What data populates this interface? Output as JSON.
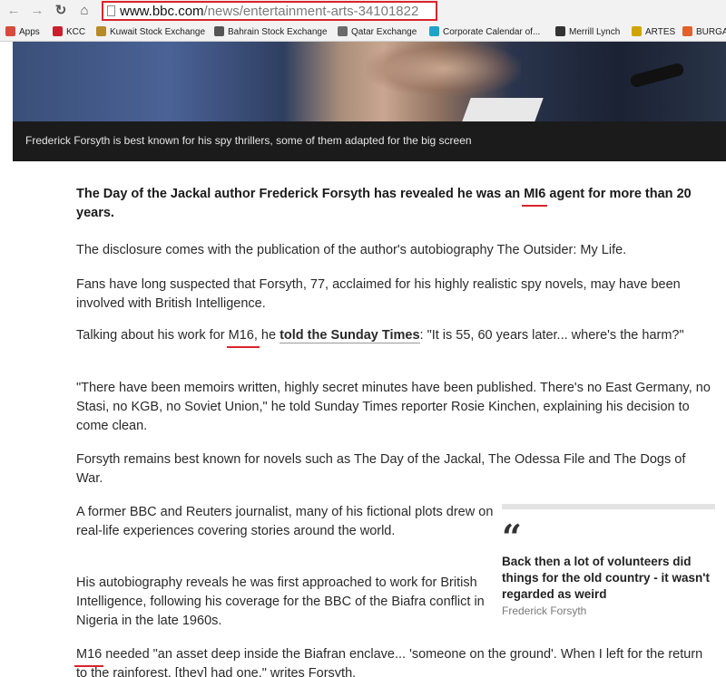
{
  "browser": {
    "url_host": "www.bbc.com",
    "url_path": "/news/entertainment-arts-34101822",
    "bookmarks": [
      {
        "label": "Apps",
        "color": "#d64b3b"
      },
      {
        "label": "KCC",
        "color": "#cc1f2d"
      },
      {
        "label": "Kuwait Stock Exchange",
        "color": "#b58b2a"
      },
      {
        "label": "Bahrain Stock Exchange",
        "color": "#555555"
      },
      {
        "label": "Qatar Exchange",
        "color": "#6b6b6b"
      },
      {
        "label": "Corporate Calendar of...",
        "color": "#1ea3c9"
      },
      {
        "label": "Merrill Lynch",
        "color": "#333333"
      },
      {
        "label": "ARTES",
        "color": "#cfa400"
      },
      {
        "label": "BURGA",
        "color": "#e0622b"
      }
    ]
  },
  "hero": {
    "caption": "Frederick Forsyth is best known for his spy thrillers, some of them adapted for the big screen"
  },
  "article": {
    "lead_a": "The Day of the Jackal author Frederick Forsyth has revealed he was an ",
    "lead_hl": "MI6",
    "lead_b": " agent for more than 20 years.",
    "p1": "The disclosure comes with the publication of the author's autobiography The Outsider: My Life.",
    "p2": "Fans have long suspected that Forsyth, 77, acclaimed for his highly realistic spy novels, may have been involved with British Intelligence.",
    "p3_a": "Talking about his work for ",
    "p3_hl": "M16,",
    "p3_b": " he ",
    "p3_link": "told the Sunday Times",
    "p3_c": ": \"It is 55, 60 years later... where's the harm?\"",
    "p4": "\"There have been memoirs written, highly secret minutes have been published. There's no East Germany, no Stasi, no KGB, no Soviet Union,\" he told Sunday Times reporter Rosie Kinchen, explaining his decision to come clean.",
    "p5": "Forsyth remains best known for novels such as The Day of the Jackal, The Odessa File and The Dogs of War.",
    "p6": "A former BBC and Reuters journalist, many of his fictional plots drew on real-life experiences covering stories around the world.",
    "p7": "His autobiography reveals he was first approached to work for British Intelligence, following his coverage for the BBC of the Biafra conflict in Nigeria in the late 1960s.",
    "p8_hl": "M16",
    "p8_b": " needed \"an asset deep inside the Biafran enclave... 'someone on the ground'. When I left for the return to the rainforest, [they] had one,\" writes Forsyth."
  },
  "quote": {
    "mark": "“",
    "text": "Back then a lot of volunteers did things for the old country - it wasn't regarded as weird",
    "author": "Frederick Forsyth"
  }
}
